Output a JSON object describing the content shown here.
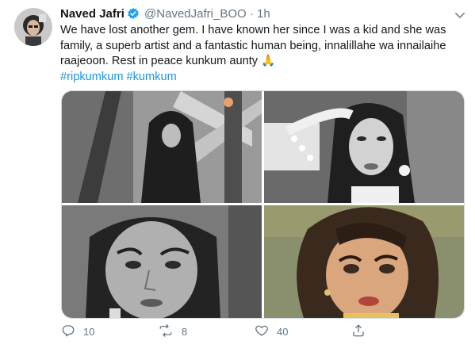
{
  "author": {
    "name": "Naved Jafri",
    "handle": "@NavedJafri_BOO",
    "separator": "·",
    "time": "1h"
  },
  "tweet": {
    "text": "We have lost another gem. I have known her since I was a kid and she was family, a superb artist and a fantastic human being, innalillahe wa innailaihe raajeoon. Rest in peace kunkum aunty 🙏",
    "hashtags": [
      "#ripkumkum",
      "#kumkum"
    ]
  },
  "actions": {
    "replies": "10",
    "retweets": "8",
    "likes": "40"
  },
  "colors": {
    "link": "#1b95e0",
    "verified": "#1da1f2",
    "muted": "#657786"
  },
  "icons": [
    "verified-badge-icon",
    "chevron-down-icon",
    "reply-icon",
    "retweet-icon",
    "like-icon",
    "share-icon"
  ]
}
